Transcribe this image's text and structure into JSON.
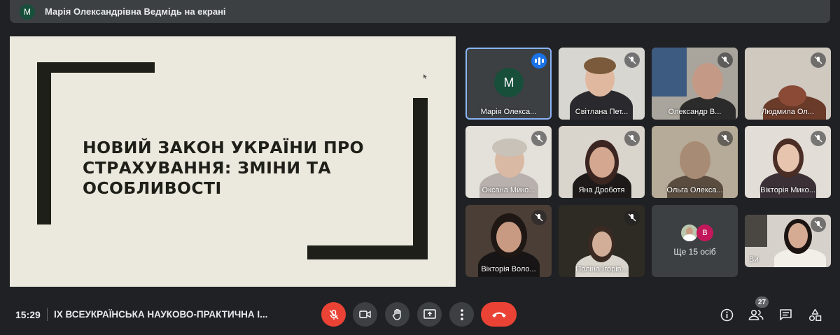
{
  "presenter_bar": {
    "avatar_letter": "M",
    "text": "Марія Олександрівна Ведмідь на екрані"
  },
  "slide": {
    "title": "НОВИЙ ЗАКОН УКРАЇНИ ПРО СТРАХУВАННЯ: ЗМІНИ ТА ОСОБЛИВОСТІ"
  },
  "participants": [
    {
      "name": "Марія Олекса...",
      "avatar": "M",
      "speaking": true
    },
    {
      "name": "Світлана Пет...",
      "muted": true
    },
    {
      "name": "Олександр В...",
      "muted": true
    },
    {
      "name": "Людмила Ол...",
      "muted": true
    },
    {
      "name": "Оксана Мико...",
      "muted": true
    },
    {
      "name": "Яна Дроботя",
      "muted": true
    },
    {
      "name": "Ольга Олекса...",
      "muted": true
    },
    {
      "name": "Вікторія Мико...",
      "muted": true
    },
    {
      "name": "Вікторія Воло...",
      "muted": true
    },
    {
      "name": "Поліна Ігорів...",
      "muted": true
    },
    {
      "name": "Ви",
      "muted": true
    }
  ],
  "more_tile": {
    "text": "Ще 15 осіб",
    "avatar_letter": "В"
  },
  "bottom_bar": {
    "time": "15:29",
    "meeting_title": "IX ВСЕУКРАЇНСЬКА НАУКОВО-ПРАКТИЧНА І...",
    "participants_count": "27"
  },
  "colors": {
    "background": "#202124",
    "surface": "#3c4043",
    "danger": "#ea4335",
    "accent": "#1a73e8",
    "avatar_green": "#174f3b"
  }
}
